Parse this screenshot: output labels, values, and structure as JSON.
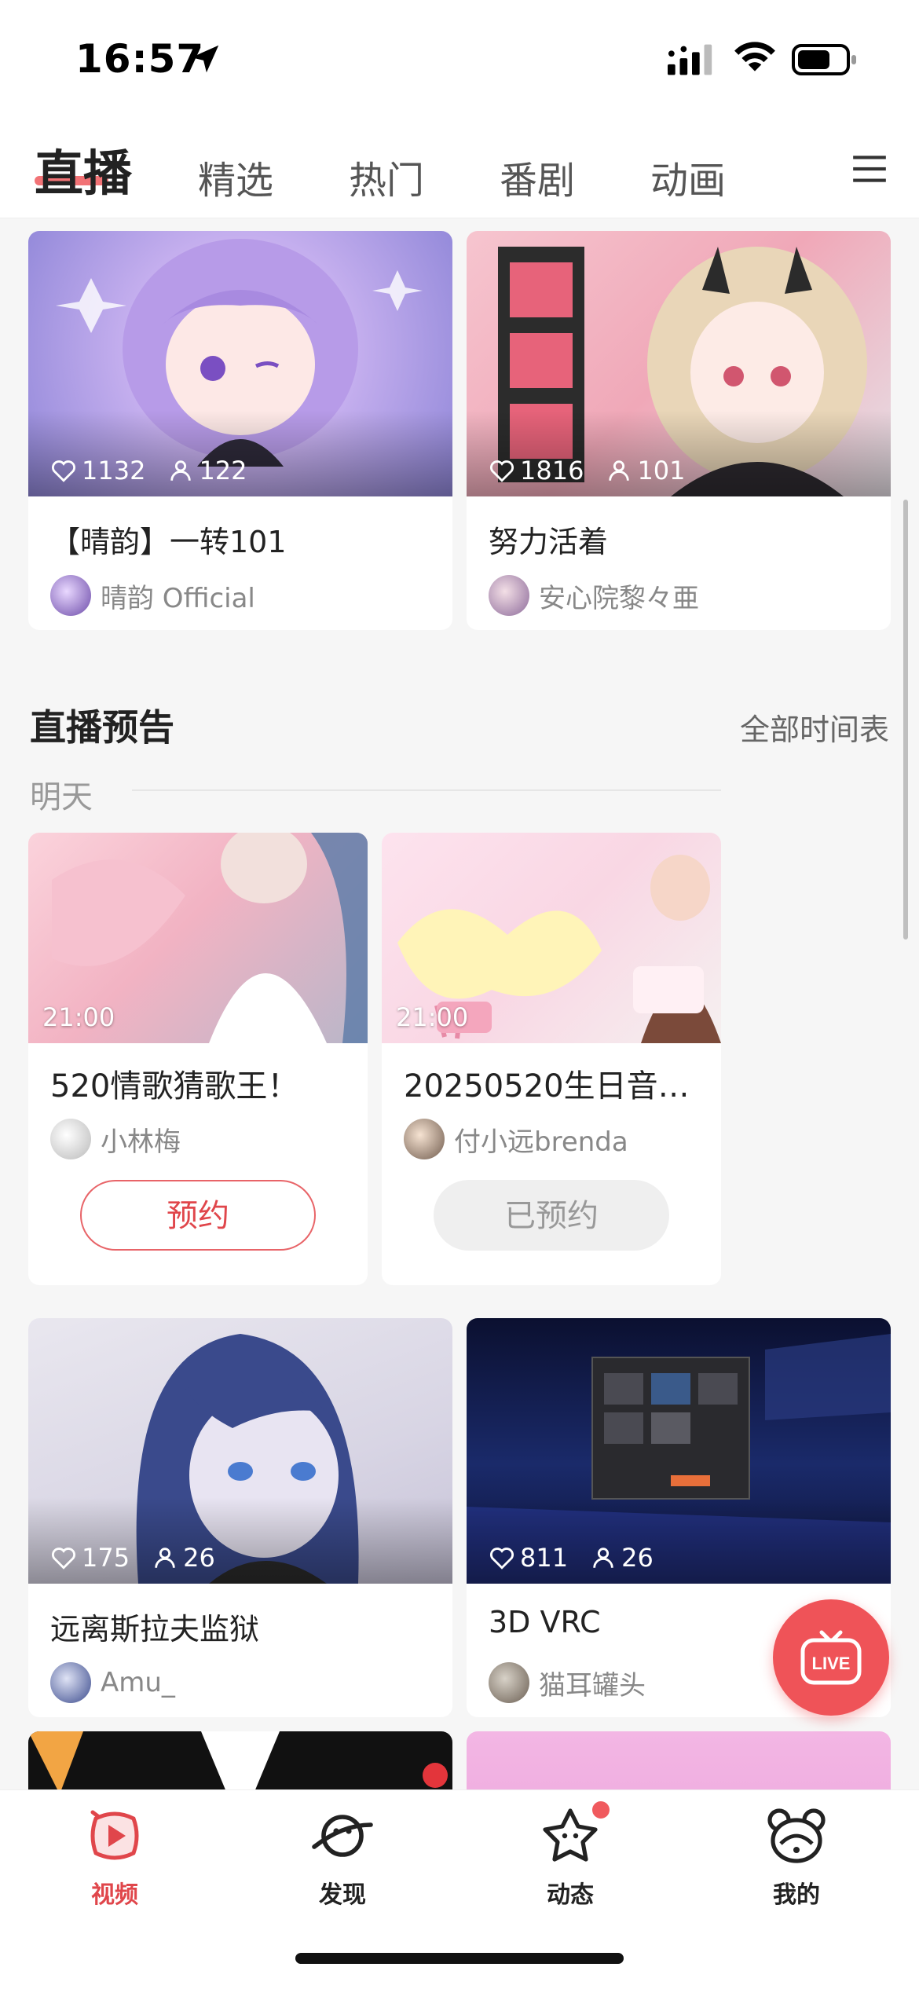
{
  "status_bar": {
    "time": "16:57"
  },
  "top_tabs": [
    {
      "label": "直播",
      "active": true
    },
    {
      "label": "精选",
      "active": false
    },
    {
      "label": "热门",
      "active": false
    },
    {
      "label": "番剧",
      "active": false
    },
    {
      "label": "动画",
      "active": false
    }
  ],
  "live_cards_top": [
    {
      "likes": "1132",
      "viewers": "122",
      "title": "【晴韵】一转101",
      "author": "晴韵 Official"
    },
    {
      "likes": "1816",
      "viewers": "101",
      "title": "努力活着",
      "author": "安心院黎々亜"
    }
  ],
  "preview_section": {
    "title": "直播预告",
    "link": "全部时间表",
    "day": "明天",
    "items": [
      {
        "time": "21:00",
        "title": "520情歌猜歌王！",
        "author": "小林梅",
        "button": "预约",
        "reserved": false
      },
      {
        "time": "21:00",
        "title": "20250520生日音…",
        "author": "付小远brenda",
        "button": "已预约",
        "reserved": true
      }
    ]
  },
  "live_cards_bottom": [
    {
      "likes": "175",
      "viewers": "26",
      "title": "远离斯拉夫监狱",
      "author": "Amu_"
    },
    {
      "likes": "811",
      "viewers": "26",
      "title": "3D VRC",
      "author": "猫耳罐头"
    }
  ],
  "fab": {
    "label": "LIVE"
  },
  "bottom_nav": [
    {
      "label": "视频",
      "icon": "video-icon",
      "active": true
    },
    {
      "label": "发现",
      "icon": "planet-icon",
      "active": false
    },
    {
      "label": "动态",
      "icon": "star-face-icon",
      "active": false
    },
    {
      "label": "我的",
      "icon": "bear-icon",
      "active": false
    }
  ],
  "colors": {
    "accent": "#e0464b",
    "background": "#f6f6f6"
  }
}
